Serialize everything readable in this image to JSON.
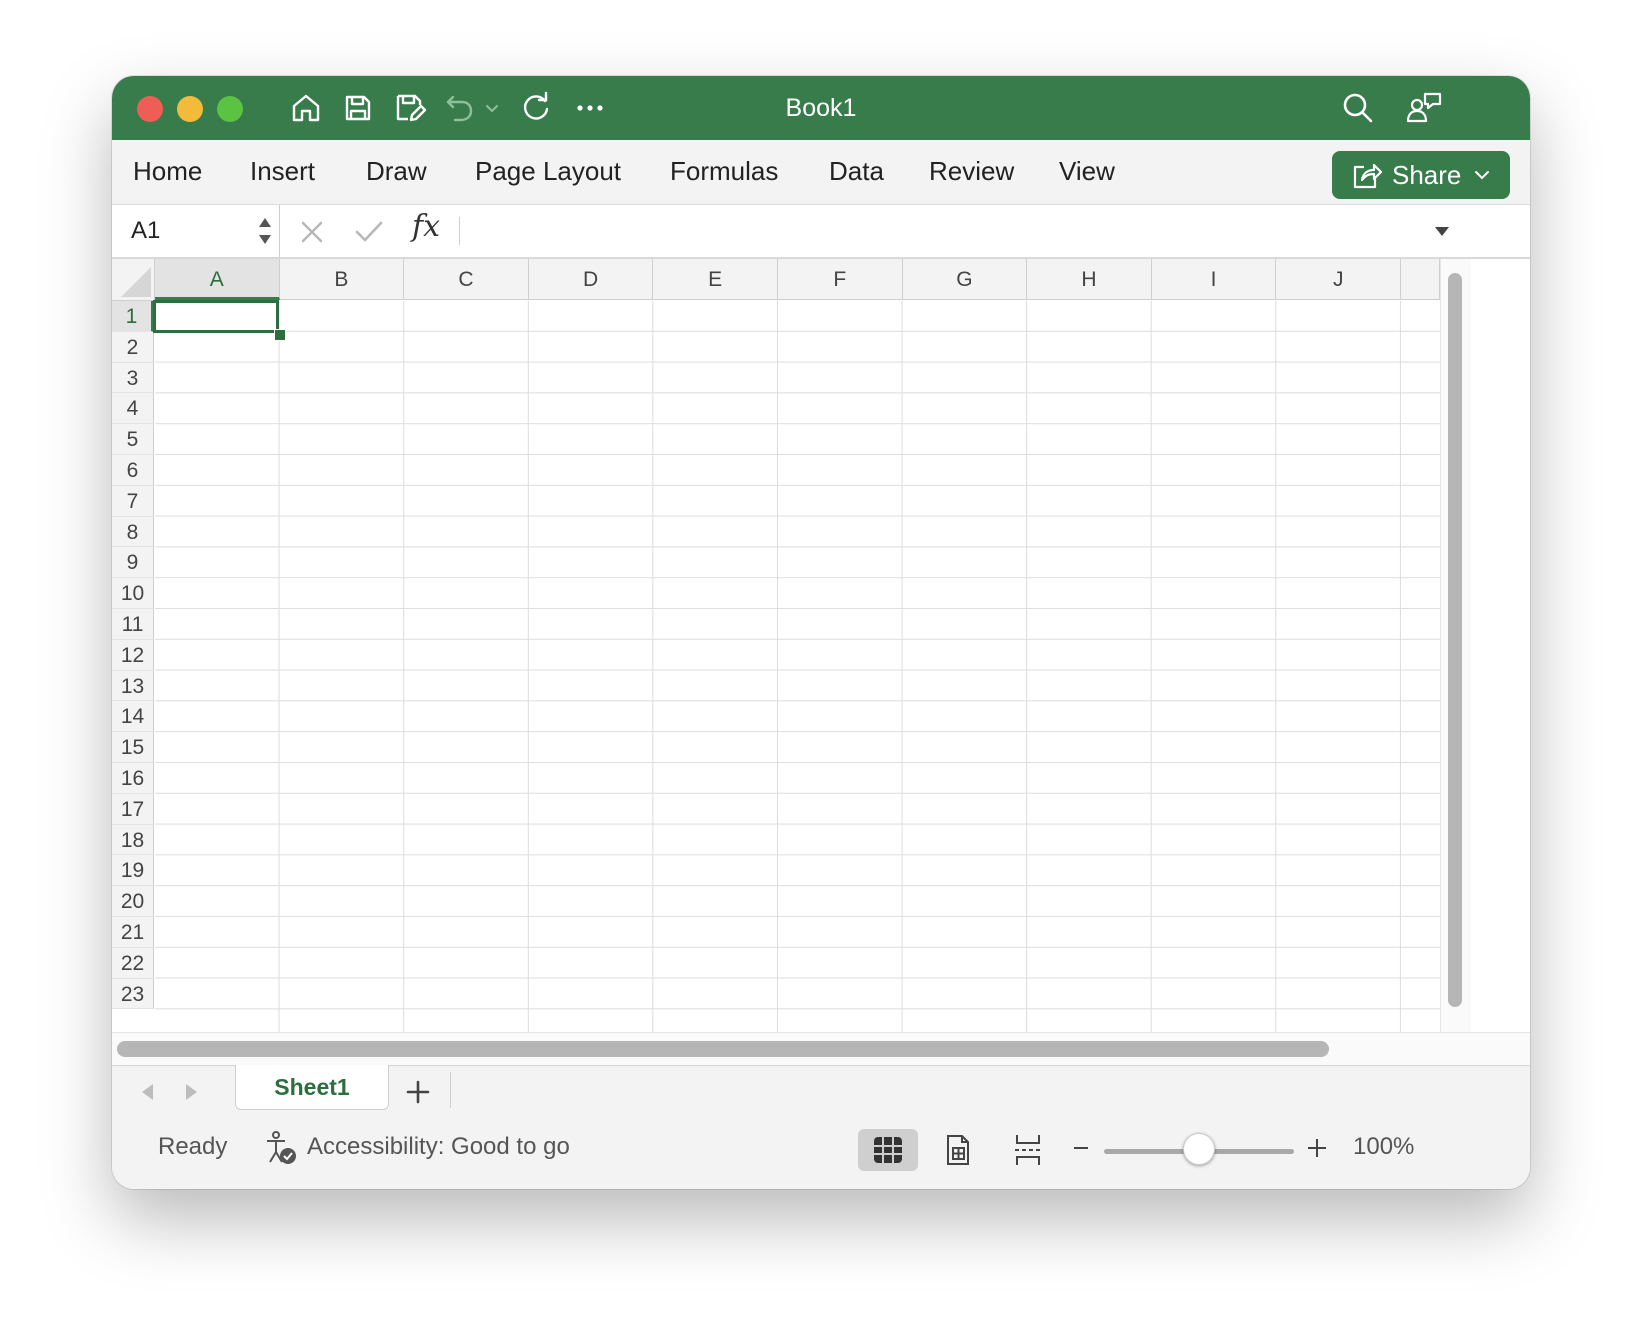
{
  "window": {
    "title": "Book1",
    "accent_color": "#377c4a",
    "traffic_lights": [
      "close",
      "minimize",
      "zoom"
    ]
  },
  "toolbar": {
    "icons": [
      "home-icon",
      "save-icon",
      "save-as-icon",
      "undo-icon",
      "chevron-down-icon",
      "redo-icon",
      "more-icon"
    ],
    "right_icons": [
      "search-icon",
      "collaborate-icon"
    ]
  },
  "menu": {
    "items": [
      "Home",
      "Insert",
      "Draw",
      "Page Layout",
      "Formulas",
      "Data",
      "Review",
      "View"
    ],
    "share_label": "Share"
  },
  "formula_bar": {
    "name_box": "A1",
    "fx_label": "fx",
    "formula_value": ""
  },
  "grid": {
    "columns": [
      "A",
      "B",
      "C",
      "D",
      "E",
      "F",
      "G",
      "H",
      "I",
      "J"
    ],
    "rows": [
      "1",
      "2",
      "3",
      "4",
      "5",
      "6",
      "7",
      "8",
      "9",
      "10",
      "11",
      "12",
      "13",
      "14",
      "15",
      "16",
      "17",
      "18",
      "19",
      "20",
      "21",
      "22",
      "23"
    ],
    "selected_cell": "A1"
  },
  "sheets": {
    "tabs": [
      "Sheet1"
    ],
    "active": "Sheet1"
  },
  "status": {
    "ready": "Ready",
    "accessibility": "Accessibility: Good to go",
    "zoom_value": "100%",
    "zoom_level": 0.5,
    "view_modes": [
      "normal-view-icon",
      "page-layout-view-icon",
      "page-break-preview-icon"
    ],
    "active_view": "normal"
  }
}
